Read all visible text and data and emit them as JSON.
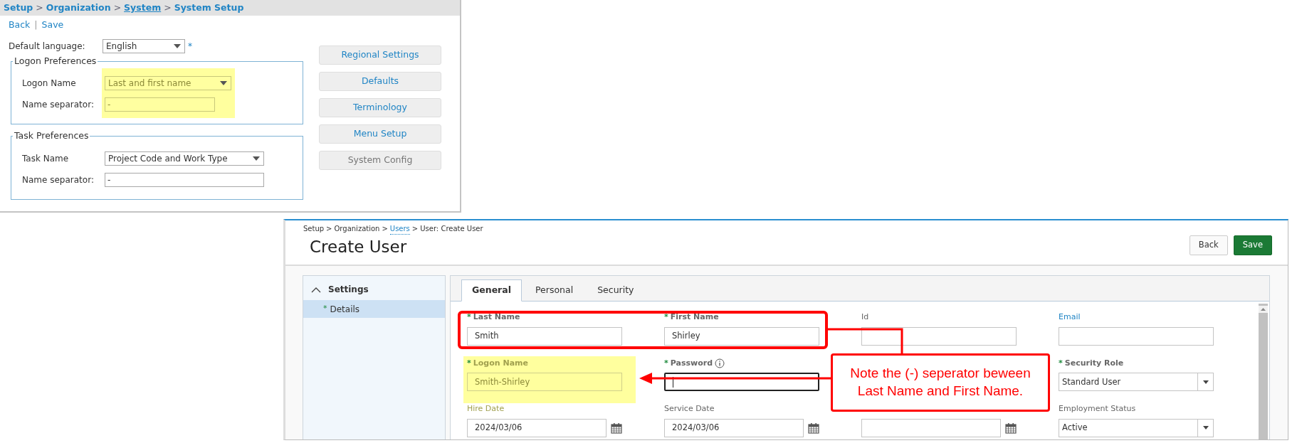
{
  "system_setup": {
    "breadcrumb": [
      {
        "text": "Setup",
        "link": false
      },
      {
        "text": "Organization",
        "link": false
      },
      {
        "text": "System",
        "link": true
      },
      {
        "text": "System Setup",
        "link": false
      }
    ],
    "breadcrumb_separator": ">",
    "actions": [
      "Back",
      "Save"
    ],
    "action_separator": "|",
    "default_language": {
      "label": "Default language:",
      "value": "English",
      "required_mark": "*"
    },
    "fieldsets": [
      {
        "legend": "Logon Preferences",
        "highlighted": true,
        "rows": [
          {
            "label": "Logon Name",
            "kind": "select",
            "value": "Last and first name"
          },
          {
            "label": "Name separator:",
            "kind": "text",
            "value": "-"
          }
        ]
      },
      {
        "legend": "Task Preferences",
        "highlighted": false,
        "rows": [
          {
            "label": "Task Name",
            "kind": "select",
            "value": "Project Code and Work Type"
          },
          {
            "label": "Name separator:",
            "kind": "text",
            "value": "-"
          }
        ]
      }
    ],
    "side_buttons": [
      {
        "label": "Regional Settings",
        "disabled": false
      },
      {
        "label": "Defaults",
        "disabled": false
      },
      {
        "label": "Terminology",
        "disabled": false
      },
      {
        "label": "Menu Setup",
        "disabled": false
      },
      {
        "label": "System Config",
        "disabled": true
      }
    ]
  },
  "create_user": {
    "breadcrumb": [
      {
        "text": "Setup",
        "link": false
      },
      {
        "text": "Organization",
        "link": false
      },
      {
        "text": "Users",
        "link": true
      },
      {
        "text": "User: Create User",
        "link": false
      }
    ],
    "breadcrumb_separator": ">",
    "title": "Create User",
    "buttons": [
      {
        "label": "Back",
        "kind": "secondary"
      },
      {
        "label": "Save",
        "kind": "primary"
      }
    ],
    "sidebar": {
      "heading": "Settings",
      "expanded": true,
      "items": [
        {
          "label": "Details",
          "required": true,
          "selected": true
        }
      ]
    },
    "tabs": [
      {
        "label": "General",
        "selected": true
      },
      {
        "label": "Personal",
        "selected": false
      },
      {
        "label": "Security",
        "selected": false
      }
    ],
    "required_mark": "*",
    "fields": [
      {
        "kind": "text",
        "label": "Last Name",
        "required": true,
        "value": "Smith"
      },
      {
        "kind": "text",
        "label": "First Name",
        "required": true,
        "value": "Shirley"
      },
      {
        "kind": "text",
        "label": "Id",
        "required": false
      },
      {
        "kind": "text",
        "label": "Email",
        "required": false,
        "link": true
      },
      {
        "kind": "text",
        "label": "Logon Name",
        "required": true,
        "value": "Smith-Shirley",
        "highlighted": true
      },
      {
        "kind": "password",
        "label": "Password",
        "required": true,
        "info": true,
        "focused": true
      },
      {
        "kind": "covered"
      },
      {
        "kind": "select",
        "label": "Security Role",
        "required": true,
        "value": "Standard User"
      },
      {
        "kind": "date",
        "label": "Hire Date",
        "required": false,
        "value": "2024/03/06"
      },
      {
        "kind": "date",
        "label": "Service Date",
        "required": false,
        "value": "2024/03/06"
      },
      {
        "kind": "date"
      },
      {
        "kind": "select",
        "label": "Employment Status",
        "required": false,
        "value": "Active"
      }
    ]
  },
  "annotation": {
    "text": "Note the (-) seperator beween\nLast Name and First Name."
  }
}
